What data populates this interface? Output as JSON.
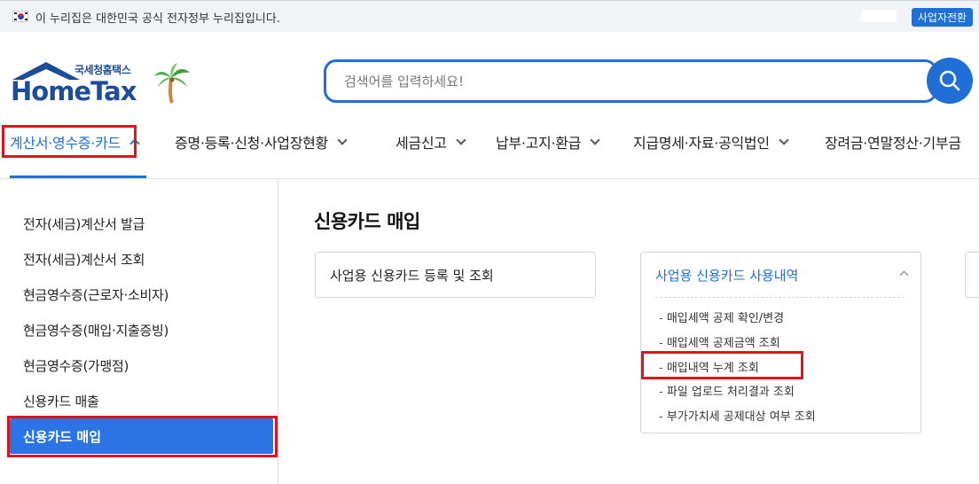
{
  "gov_banner": {
    "text": "이 누리집은 대한민국 공식 전자정부 누리집입니다.",
    "switch_button": "사업자전환"
  },
  "logo": {
    "subtitle": "국세청홈택스",
    "name": "HomeTax"
  },
  "search": {
    "placeholder": "검색어를 입력하세요!"
  },
  "nav": {
    "items": [
      {
        "label": "계산서·영수증·카드",
        "active": true
      },
      {
        "label": "증명·등록·신청·사업장현황"
      },
      {
        "label": "세금신고"
      },
      {
        "label": "납부·고지·환급"
      },
      {
        "label": "지급명세·자료·공익법인"
      },
      {
        "label": "장려금·연말정산·기부금"
      }
    ]
  },
  "sidebar": {
    "items": [
      {
        "label": "전자(세금)계산서 발급"
      },
      {
        "label": "전자(세금)계산서 조회"
      },
      {
        "label": "현금영수증(근로자·소비자)"
      },
      {
        "label": "현금영수증(매입·지출증빙)"
      },
      {
        "label": "현금영수증(가맹점)"
      },
      {
        "label": "신용카드 매출"
      },
      {
        "label": "신용카드 매입",
        "active": true
      }
    ]
  },
  "main": {
    "title": "신용카드 매입",
    "card1": {
      "label": "사업용 신용카드 등록 및 조회"
    },
    "card2": {
      "label": "사업용 신용카드 사용내역",
      "items": [
        {
          "label": "매입세액 공제 확인/변경"
        },
        {
          "label": "매입세액 공제금액 조회"
        },
        {
          "label": "매입내역 누계 조회"
        },
        {
          "label": "파일 업로드 처리결과 조회"
        },
        {
          "label": "부가가치세 공제대상 여부 조회"
        }
      ]
    }
  },
  "colors": {
    "accent": "#1f6fd6",
    "highlight": "#e0141e",
    "logo": "#1c4d9c"
  }
}
